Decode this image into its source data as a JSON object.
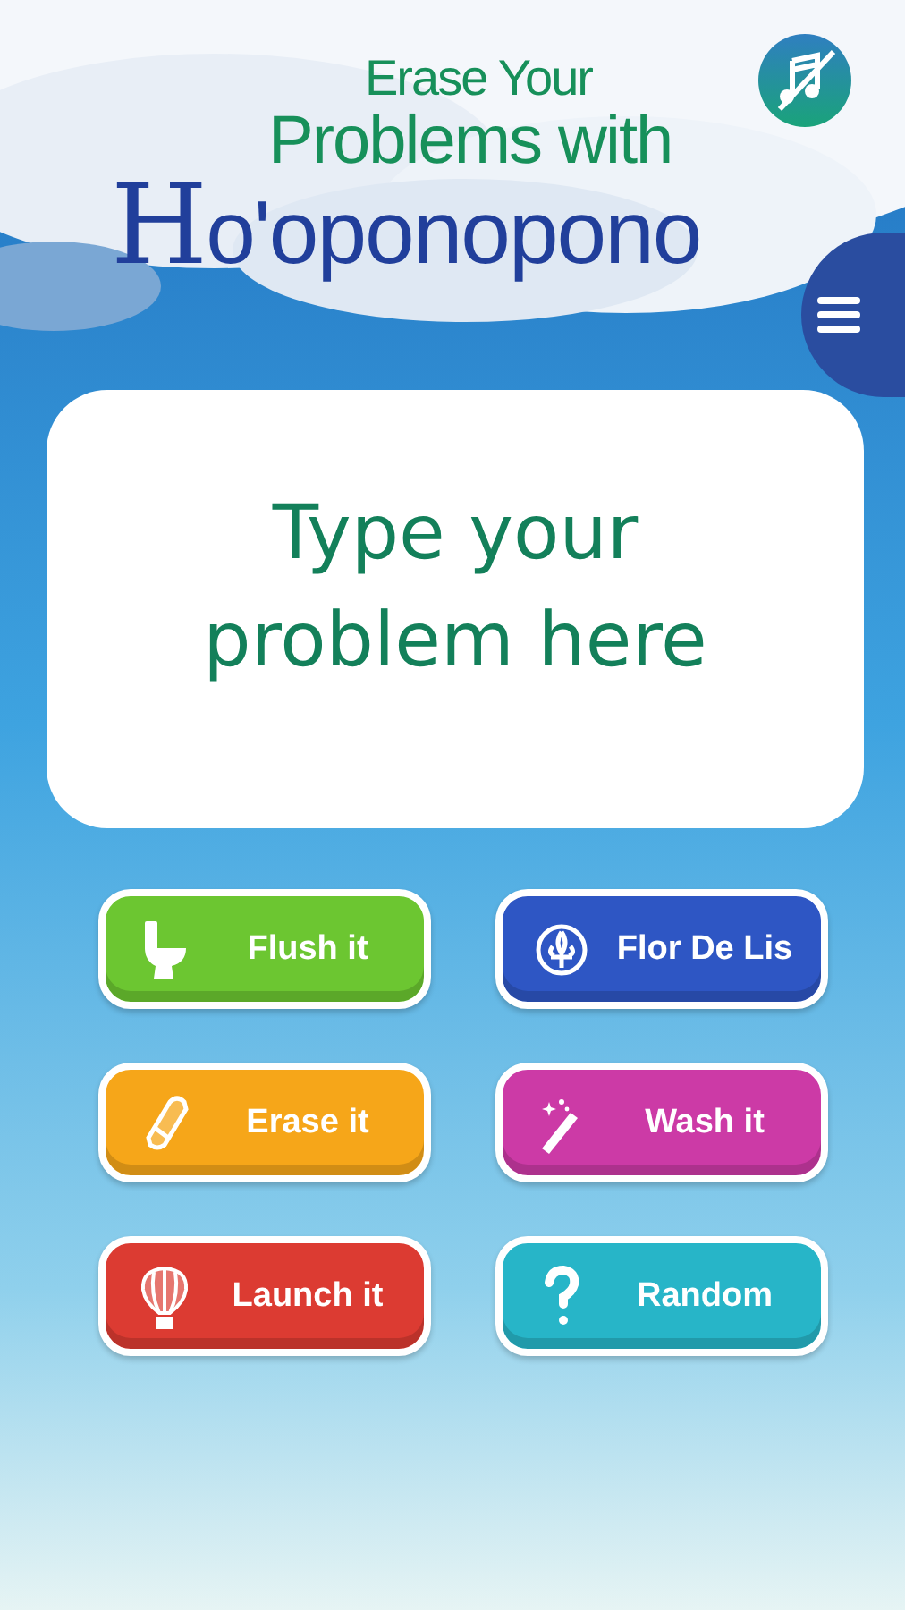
{
  "logo": {
    "lines": [
      "Erase Your",
      "Problems with",
      "Ho'oponopono"
    ]
  },
  "problem_field": {
    "placeholder": "Type your problem here"
  },
  "buttons": [
    {
      "label": "Flush it",
      "kind": "toilet",
      "color": "#6cc631"
    },
    {
      "label": "Flor De Lis",
      "kind": "fleur",
      "color": "#2e56c4"
    },
    {
      "label": "Erase it",
      "kind": "eraser",
      "color": "#f6a619"
    },
    {
      "label": "Wash it",
      "kind": "wand",
      "color": "#cc3aa6"
    },
    {
      "label": "Launch it",
      "kind": "balloon",
      "color": "#dc3b32"
    },
    {
      "label": "Random",
      "kind": "question",
      "color": "#27b5c8"
    }
  ]
}
